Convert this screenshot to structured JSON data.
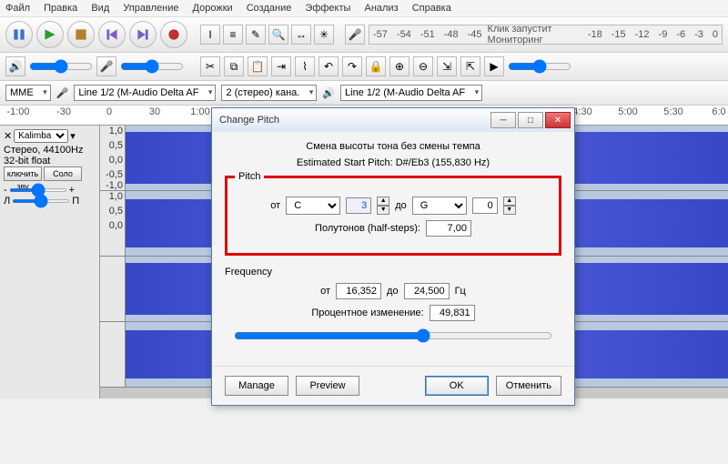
{
  "menu": [
    "Файл",
    "Правка",
    "Вид",
    "Управление",
    "Дорожки",
    "Создание",
    "Эффекты",
    "Анализ",
    "Справка"
  ],
  "meter": {
    "click_text": "Клик запустит Мониторинг",
    "ticks": [
      "-57",
      "-54",
      "-51",
      "-48",
      "-45",
      "-18",
      "-15",
      "-12",
      "-9",
      "-6",
      "-3",
      "0"
    ]
  },
  "devices": {
    "host": "MME",
    "input": "Line 1/2 (M-Audio Delta AF",
    "channels": "2 (стерео) кана.",
    "output": "Line 1/2 (M-Audio Delta AF"
  },
  "ruler": [
    "-1:00",
    "-30",
    "0",
    "30",
    "1:00",
    "4:30",
    "5:00",
    "5:30",
    "6:0"
  ],
  "track": {
    "name": "Kalimba",
    "info1": "Стерео, 44100Hz",
    "info2": "32-bit float",
    "mute": "ключить зву",
    "solo": "Соло",
    "gain_l": "-",
    "gain_r": "+",
    "pan_l": "Л",
    "pan_r": "П",
    "scale": [
      "1,0",
      "0,5",
      "0,0",
      "-0,5",
      "-1,0",
      "1,0",
      "0,5",
      "0,0"
    ]
  },
  "dialog": {
    "title": "Change Pitch",
    "headline": "Смена высоты тона без смены темпа",
    "estimated": "Estimated Start Pitch: D#/Eb3 (155,830 Hz)",
    "pitch_legend": "Pitch",
    "from_label": "от",
    "to_label": "до",
    "from_note": "C",
    "from_oct": "3",
    "to_note": "G",
    "to_oct": "0",
    "halfsteps_label": "Полутонов (half-steps):",
    "halfsteps": "7,00",
    "freq_legend": "Frequency",
    "freq_from": "16,352",
    "freq_to": "24,500",
    "hz": "Гц",
    "percent_label": "Процентное изменение:",
    "percent": "49,831",
    "manage": "Manage",
    "preview": "Preview",
    "ok": "OK",
    "cancel": "Отменить"
  }
}
